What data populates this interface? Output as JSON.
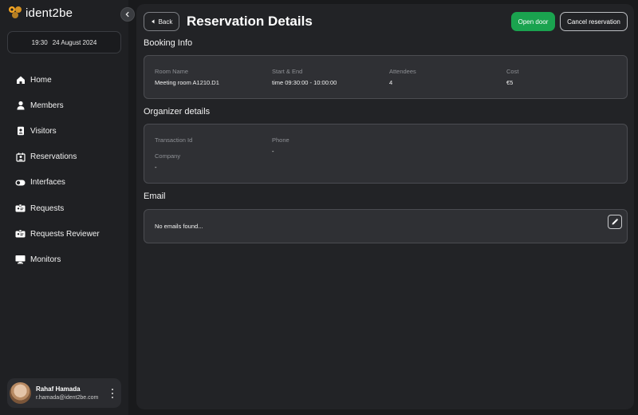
{
  "app": {
    "logo_text": "ident2be"
  },
  "sidebar": {
    "time": "19:30",
    "date": "24 August 2024",
    "items": [
      {
        "label": "Home",
        "icon": "home-icon"
      },
      {
        "label": "Members",
        "icon": "person-icon"
      },
      {
        "label": "Visitors",
        "icon": "visitor-badge-icon"
      },
      {
        "label": "Reservations",
        "icon": "reservations-icon"
      },
      {
        "label": "Interfaces",
        "icon": "toggle-icon"
      },
      {
        "label": "Requests",
        "icon": "id-card-icon"
      },
      {
        "label": "Requests Reviewer",
        "icon": "id-card-review-icon"
      },
      {
        "label": "Monitors",
        "icon": "monitor-icon"
      }
    ],
    "user": {
      "name": "Rahaf Hamada",
      "email": "r.hamada@ident2be.com"
    }
  },
  "header": {
    "back_label": "Back",
    "title": "Reservation Details",
    "open_door_label": "Open door",
    "cancel_label": "Cancel reservation"
  },
  "booking": {
    "title": "Booking Info",
    "room_label": "Room Name",
    "room_value": "Meeting room A1210.D1",
    "time_label": "Start & End",
    "time_value": "time 09:30:00 - 10:00:00",
    "attendees_label": "Attendees",
    "attendees_value": "4",
    "cost_label": "Cost",
    "cost_value": "€5"
  },
  "organizer": {
    "title": "Organizer details",
    "transaction_label": "Transaction Id",
    "phone_label": "Phone",
    "phone_value": "-",
    "company_label": "Company",
    "company_value": "-"
  },
  "email": {
    "title": "Email",
    "empty_message": "No emails found..."
  },
  "colors": {
    "accent_green": "#1aa34f",
    "logo_orange": "#f5a623"
  }
}
